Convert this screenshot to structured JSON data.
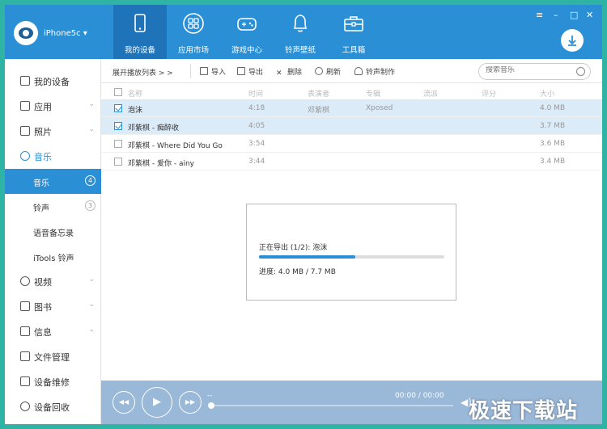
{
  "header": {
    "device_name": "iPhone5c ▾",
    "tabs": [
      {
        "label": "我的设备",
        "icon": "phone-icon",
        "active": true
      },
      {
        "label": "应用市场",
        "icon": "apps-icon",
        "active": false
      },
      {
        "label": "游戏中心",
        "icon": "gamepad-icon",
        "active": false
      },
      {
        "label": "铃声壁纸",
        "icon": "bell-icon",
        "active": false
      },
      {
        "label": "工具箱",
        "icon": "toolbox-icon",
        "active": false
      }
    ],
    "window_controls": {
      "menu": "≡",
      "minimize": "–",
      "maximize": "□",
      "close": "✕"
    },
    "accent": "#2b8fd6"
  },
  "sidebar": {
    "items": [
      {
        "label": "我的设备",
        "icon": "phone-icon"
      },
      {
        "label": "应用",
        "icon": "apps-icon",
        "chevron": "⌄"
      },
      {
        "label": "照片",
        "icon": "photo-icon",
        "chevron": "⌄"
      },
      {
        "label": "音乐",
        "icon": "music-icon"
      },
      {
        "label": "视频",
        "icon": "video-icon",
        "chevron": "⌄"
      },
      {
        "label": "图书",
        "icon": "book-icon",
        "chevron": "⌄"
      },
      {
        "label": "信息",
        "icon": "message-icon",
        "chevron": "⌄"
      },
      {
        "label": "文件管理",
        "icon": "folder-icon"
      },
      {
        "label": "设备维修",
        "icon": "wrench-icon"
      },
      {
        "label": "设备回收",
        "icon": "recycle-icon"
      }
    ],
    "music_sub": [
      {
        "label": "音乐",
        "badge": "4",
        "active": true
      },
      {
        "label": "铃声",
        "badge": "3",
        "active": false
      },
      {
        "label": "语音备忘录",
        "badge": "",
        "active": false
      },
      {
        "label": "iTools 铃声",
        "badge": "",
        "active": false
      }
    ]
  },
  "toolbar": {
    "expand_label": "展开播放列表 > >",
    "import_label": "导入",
    "export_label": "导出",
    "delete_label": "删除",
    "refresh_label": "刷新",
    "ringtone_label": "铃声制作",
    "search_placeholder": "搜索音乐"
  },
  "table": {
    "columns": [
      "名称",
      "时间",
      "表演者",
      "专辑",
      "流派",
      "评分",
      "大小"
    ],
    "rows": [
      {
        "checked": true,
        "selected": true,
        "name": "泡沫",
        "time": "4:18",
        "artist": "邓紫棋",
        "album": "Xposed",
        "size": "4.0 MB"
      },
      {
        "checked": true,
        "selected": true,
        "name": "邓紫棋 - 痴醉收",
        "time": "4:05",
        "artist": "",
        "album": "",
        "size": "3.7 MB"
      },
      {
        "checked": false,
        "selected": false,
        "name": "邓紫棋 - Where Did You Go",
        "time": "3:54",
        "artist": "",
        "album": "",
        "size": "3.6 MB"
      },
      {
        "checked": false,
        "selected": false,
        "name": "邓紫棋 - 爱你 - ainy",
        "time": "3:44",
        "artist": "",
        "album": "",
        "size": "3.4 MB"
      }
    ]
  },
  "export_dialog": {
    "status": "正在导出 (1/2): 泡沫",
    "progress_text": "进度: 4.0 MB / 7.7 MB",
    "progress_fraction": 0.52
  },
  "player": {
    "prev": "◀◀",
    "play": "▶",
    "next": "▶▶",
    "track": "--",
    "time": "00:00 / 00:00",
    "volume": "◀)"
  },
  "watermark": "极速下载站"
}
